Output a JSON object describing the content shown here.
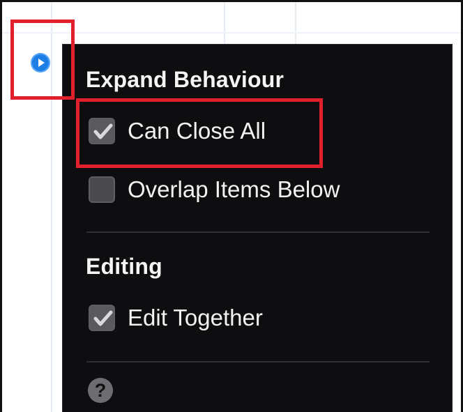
{
  "trigger": {
    "icon": "play-circle-icon",
    "color": "#1d7fe6"
  },
  "panel": {
    "sections": [
      {
        "title": "Expand Behaviour",
        "options": [
          {
            "label": "Can Close All",
            "checked": true
          },
          {
            "label": "Overlap Items Below",
            "checked": false
          }
        ]
      },
      {
        "title": "Editing",
        "options": [
          {
            "label": "Edit Together",
            "checked": true
          }
        ]
      }
    ],
    "help_label": "?"
  },
  "highlight_color": "#e0202c"
}
